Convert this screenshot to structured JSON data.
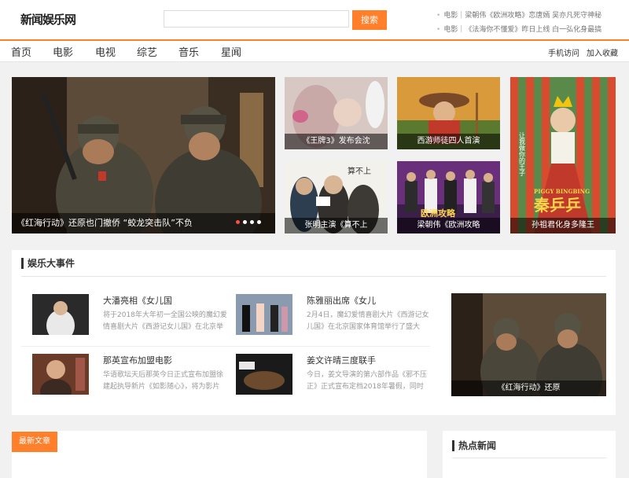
{
  "site": {
    "logo": "新闻娱乐网"
  },
  "search": {
    "placeholder": "",
    "button": "搜索"
  },
  "headlines": [
    "电影｜梁朝伟《欧洲攻略》恋唐嫣 吴亦凡死守神秘",
    "电影｜《法海你不懂爱》昨日上线 白一弘化身最搞"
  ],
  "nav": {
    "items": [
      "首页",
      "电影",
      "电视",
      "综艺",
      "音乐",
      "星闻"
    ],
    "right": [
      "手机访问",
      "加入收藏"
    ]
  },
  "hero": {
    "caption": "《红海行动》还原也门撤侨 “蛟龙突击队”不负"
  },
  "tiles": [
    "《王牌3》发布会沈",
    "西游师徒四人首演",
    "张明主演《算不上",
    "梁朝伟《欧洲攻略",
    "孙祖君化身多隆王"
  ],
  "tile_art_text": {
    "poster_vertical": "让我做你的王子",
    "poster_title": "秦乒乒",
    "poster_sub": "PIGGY BINGBING",
    "europe": "欧洲攻略",
    "movie_board": "算不上"
  },
  "events": {
    "title": "娱乐大事件",
    "items": [
      {
        "title": "大潘亮相《女儿国",
        "desc": "将于2018年大年初一全国公映的魔幻爱情喜剧大片《西游记女儿国》在北京举"
      },
      {
        "title": "陈雅丽出席《女儿",
        "desc": "2月4日，魔幻爱情喜剧大片《西游记女儿国》在北京国家体育馆举行了盛大"
      },
      {
        "title": "那英宣布加盟电影",
        "desc": "华语歌坛天后那英今日正式宣布加盟徐建起执导新片《如影随心》，将为影片"
      },
      {
        "title": "姜文许晴三度联手",
        "desc": "今日，姜文导演的第六部作品《邪不压正》正式宣布定档2018年暑假，同时"
      }
    ],
    "feature_caption": "《红海行动》还原"
  },
  "latest": {
    "label": "最新文章"
  },
  "hot": {
    "title": "热点新闻"
  },
  "colors": {
    "accent": "#ff7f2a",
    "active_dot": "#ff4d3f"
  }
}
